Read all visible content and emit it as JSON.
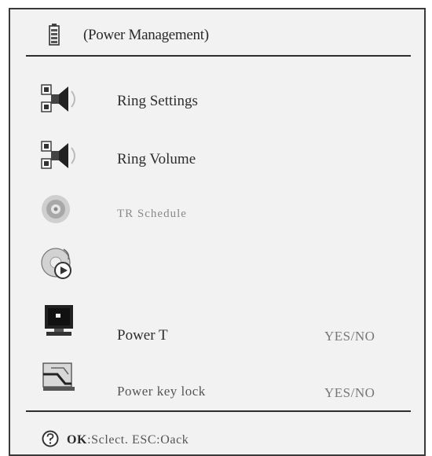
{
  "header": {
    "title": "(Power Management)",
    "icon": "battery-icon"
  },
  "menu": {
    "items": [
      {
        "label": "Ring Settings",
        "icon": "speaker-icon",
        "value": ""
      },
      {
        "label": "Ring Volume",
        "icon": "speaker-icon",
        "value": ""
      },
      {
        "label": "TR Schedule",
        "icon": "disc-icon",
        "value": ""
      },
      {
        "label": "",
        "icon": "play-disc-icon",
        "value": ""
      },
      {
        "label": "Power T",
        "icon": "monitor-icon",
        "value": "YES/NO"
      },
      {
        "label": "Power key lock",
        "icon": "key-icon",
        "value": "YES/NO"
      }
    ]
  },
  "footer": {
    "ok_key": "OK",
    "hint": ":Sclect.  ESC:Oack",
    "icon": "help-icon"
  }
}
